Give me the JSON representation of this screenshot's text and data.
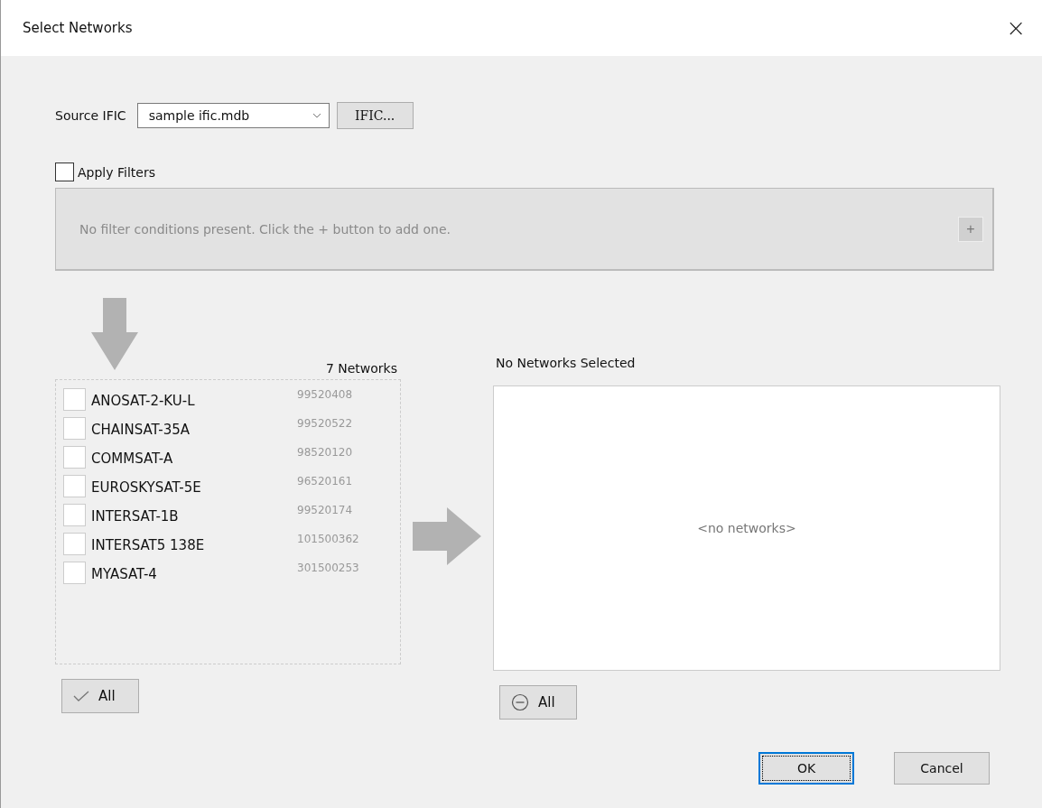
{
  "window": {
    "title": "Select Networks",
    "close": "×"
  },
  "source": {
    "label": "Source IFIC",
    "value": "sample ific.mdb",
    "browse_button": "IFIC..."
  },
  "apply_filters": {
    "label": "Apply Filters",
    "checked": false
  },
  "filter_panel": {
    "message": "No filter conditions present. Click the + button to add one.",
    "add_button": "+"
  },
  "available": {
    "count_label": "7 Networks",
    "select_all_button": "All",
    "networks": [
      {
        "name": "ANOSAT-2-KU-L",
        "id": "99520408",
        "checked": false
      },
      {
        "name": "CHAINSAT-35A",
        "id": "99520522",
        "checked": false
      },
      {
        "name": "COMMSAT-A",
        "id": "98520120",
        "checked": false
      },
      {
        "name": "EUROSKYSAT-5E",
        "id": "96520161",
        "checked": false
      },
      {
        "name": "INTERSAT-1B",
        "id": "99520174",
        "checked": false
      },
      {
        "name": "INTERSAT5 138E",
        "id": "101500362",
        "checked": false
      },
      {
        "name": "MYASAT-4",
        "id": "301500253",
        "checked": false
      }
    ]
  },
  "selected": {
    "title": "No Networks Selected",
    "empty_text": "<no networks>",
    "remove_all_button": "All"
  },
  "buttons": [
    {
      "label": "OK",
      "default": true
    },
    {
      "label": "Cancel",
      "default": false
    }
  ]
}
